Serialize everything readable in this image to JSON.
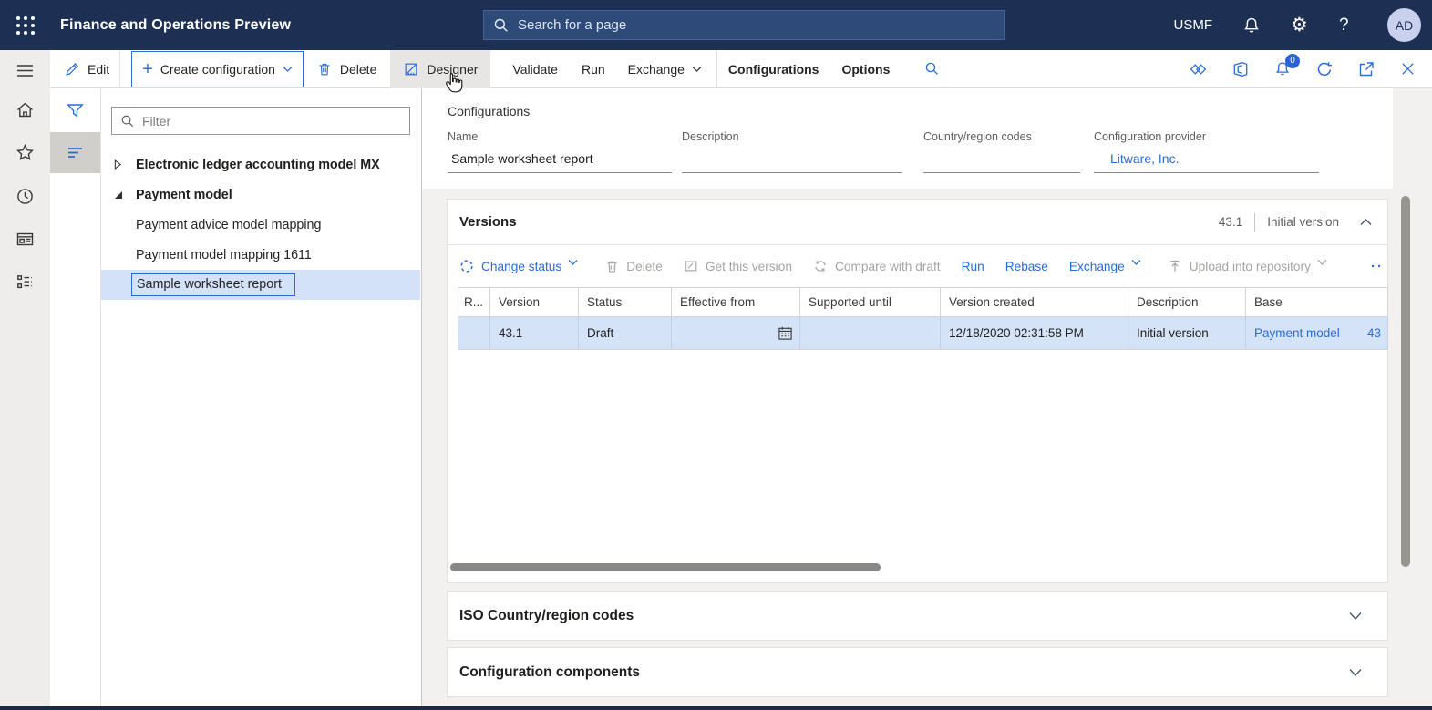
{
  "topbar": {
    "title": "Finance and Operations Preview",
    "search_placeholder": "Search for a page",
    "company": "USMF",
    "avatar": "AD"
  },
  "actionbar": {
    "edit": "Edit",
    "create_configuration": "Create configuration",
    "delete": "Delete",
    "designer": "Designer",
    "validate": "Validate",
    "run": "Run",
    "exchange": "Exchange",
    "configurations": "Configurations",
    "options": "Options",
    "notification_badge": "0"
  },
  "navpane": {
    "filter_placeholder": "Filter",
    "items": [
      {
        "label": "Electronic ledger accounting model MX",
        "state": "collapsed"
      },
      {
        "label": "Payment model",
        "state": "expanded"
      },
      {
        "label": "Payment advice model mapping"
      },
      {
        "label": "Payment model mapping 1611"
      },
      {
        "label": "Sample worksheet report",
        "selected": true
      }
    ]
  },
  "page": {
    "title": "Configurations",
    "fields": {
      "name_label": "Name",
      "name_value": "Sample worksheet report",
      "description_label": "Description",
      "description_value": "",
      "country_label": "Country/region codes",
      "country_value": "",
      "provider_label": "Configuration provider",
      "provider_value": "Litware, Inc."
    }
  },
  "versions": {
    "title": "Versions",
    "current_version": "43.1",
    "current_label": "Initial version",
    "toolbar": {
      "change_status": "Change status",
      "delete": "Delete",
      "get_this_version": "Get this version",
      "compare_with_draft": "Compare with draft",
      "run": "Run",
      "rebase": "Rebase",
      "exchange": "Exchange",
      "upload": "Upload into repository",
      "more": "··"
    },
    "table": {
      "columns": [
        "R...",
        "Version",
        "Status",
        "Effective from",
        "Supported until",
        "Version created",
        "Description",
        "Base"
      ],
      "row": {
        "version": "43.1",
        "status": "Draft",
        "effective_from": "",
        "supported_until": "",
        "version_created": "12/18/2020 02:31:58 PM",
        "description": "Initial version",
        "base": "Payment model",
        "base_version": "43"
      }
    }
  },
  "sections": {
    "iso": "ISO Country/region codes",
    "components": "Configuration components"
  },
  "colors": {
    "topbar_bg": "#1d3054",
    "accent": "#2b6cd9",
    "selected_row": "#d5e3f8"
  }
}
